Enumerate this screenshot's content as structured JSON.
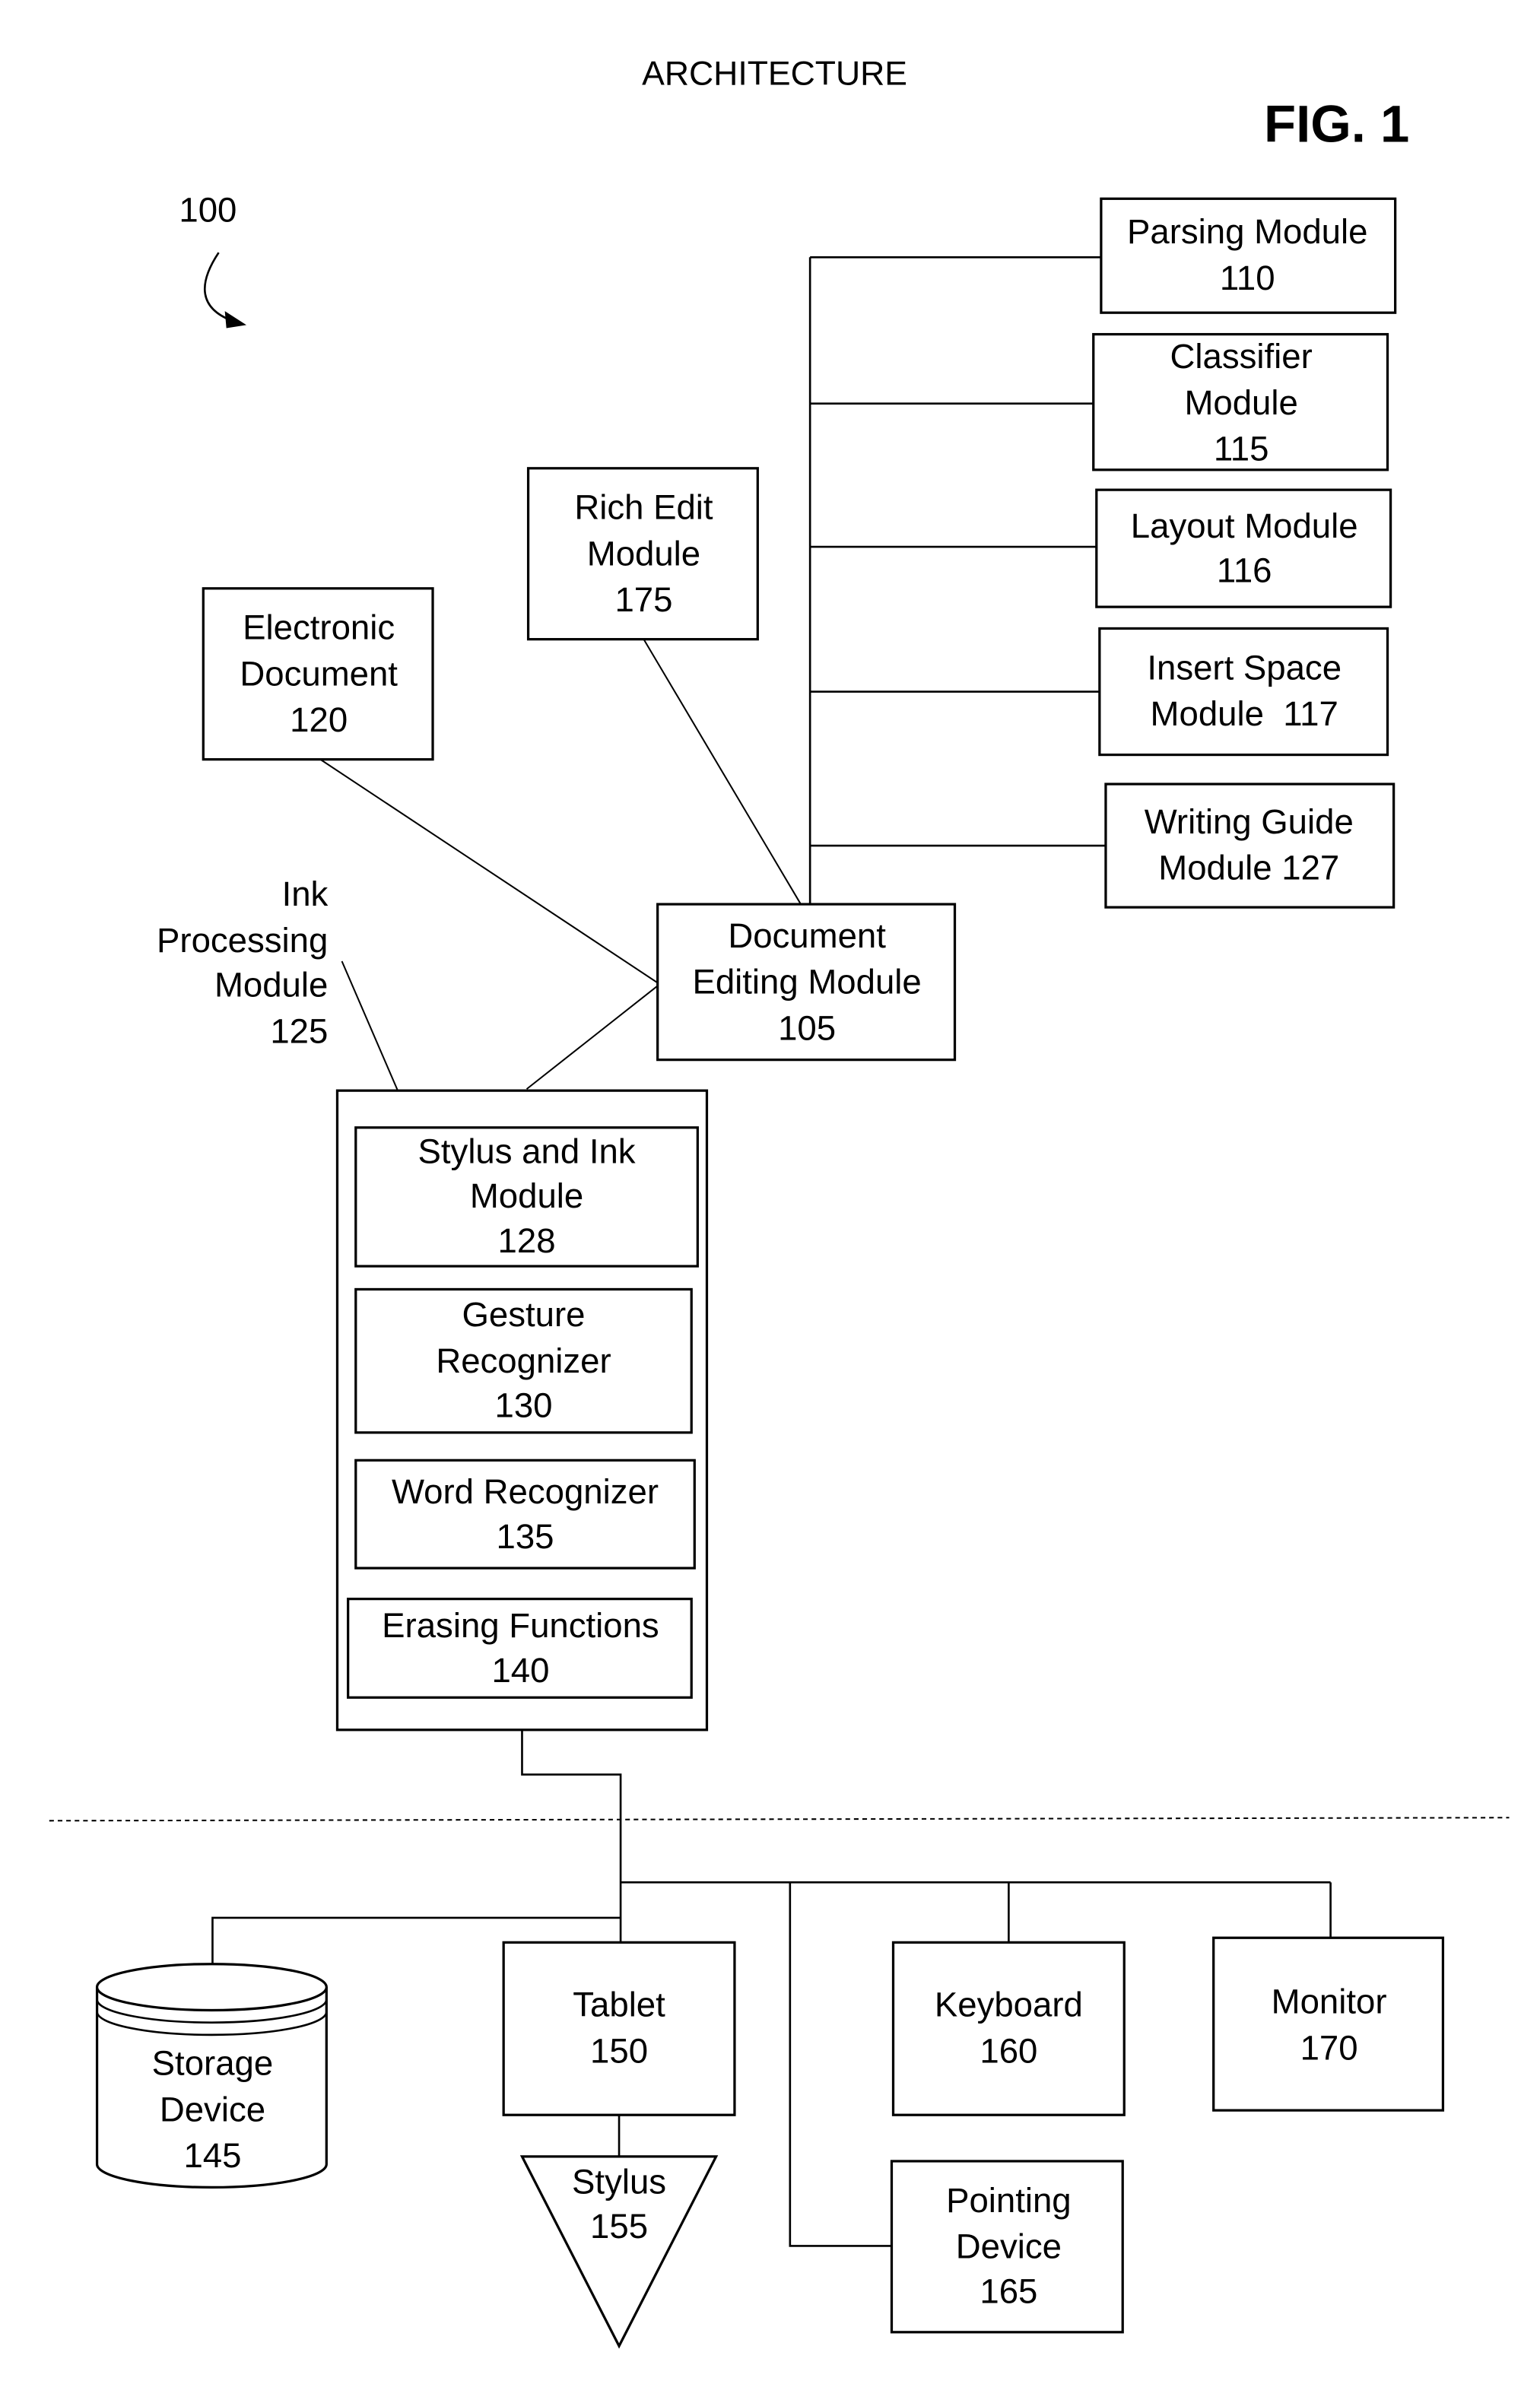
{
  "title": "ARCHITECTURE",
  "figure_label": "FIG. 1",
  "reference_number": "100",
  "colors": {
    "stroke": "#000000",
    "background": "#ffffff"
  },
  "nodes": {
    "parsing": {
      "lines": [
        "Parsing Module",
        "110"
      ]
    },
    "classifier": {
      "lines": [
        "Classifier",
        "Module",
        "115"
      ]
    },
    "layout": {
      "lines": [
        "Layout Module",
        "116"
      ]
    },
    "insert_space": {
      "lines": [
        "Insert Space",
        "Module  117"
      ]
    },
    "writing_guide": {
      "lines": [
        "Writing Guide",
        "Module 127"
      ]
    },
    "rich_edit": {
      "lines": [
        "Rich Edit",
        "Module",
        "175"
      ]
    },
    "electronic_document": {
      "lines": [
        "Electronic",
        "Document",
        "120"
      ]
    },
    "document_editing": {
      "lines": [
        "Document",
        "Editing Module",
        "105"
      ]
    },
    "ink_processing_label": {
      "lines": [
        "Ink",
        "Processing",
        "Module",
        "125"
      ]
    },
    "stylus_ink": {
      "lines": [
        "Stylus and Ink",
        "Module",
        "128"
      ]
    },
    "gesture": {
      "lines": [
        "Gesture",
        "Recognizer",
        "130"
      ]
    },
    "word": {
      "lines": [
        "Word Recognizer",
        "135"
      ]
    },
    "erasing": {
      "lines": [
        "Erasing Functions",
        "140"
      ]
    },
    "storage": {
      "lines": [
        "Storage",
        "Device",
        "145"
      ]
    },
    "tablet": {
      "lines": [
        "Tablet",
        "150"
      ]
    },
    "stylus": {
      "lines": [
        "Stylus",
        "155"
      ]
    },
    "keyboard": {
      "lines": [
        "Keyboard",
        "160"
      ]
    },
    "monitor": {
      "lines": [
        "Monitor",
        "170"
      ]
    },
    "pointing": {
      "lines": [
        "Pointing",
        "Device",
        "165"
      ]
    }
  }
}
